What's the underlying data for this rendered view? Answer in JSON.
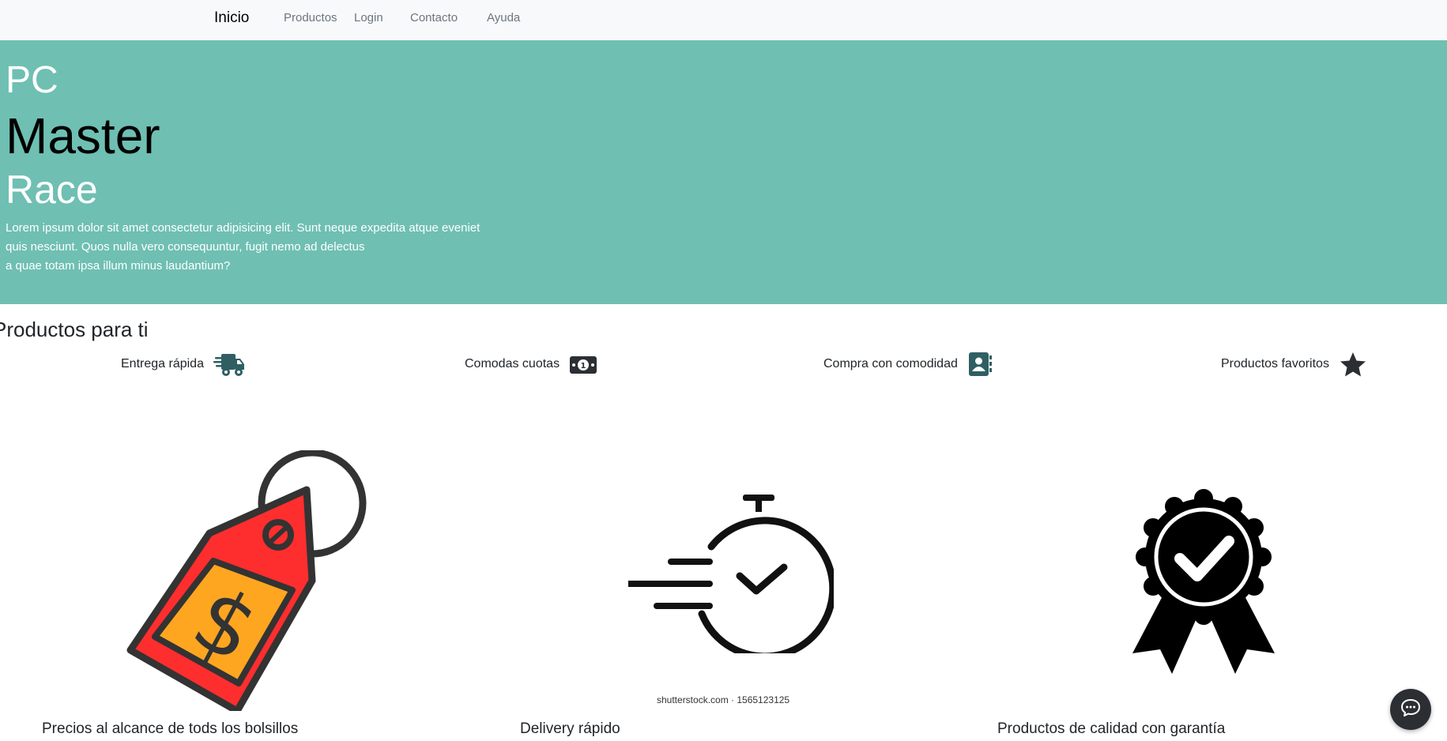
{
  "nav": {
    "brand": "Inicio",
    "links": [
      "Productos",
      "Login",
      "Contacto",
      "Ayuda"
    ]
  },
  "hero": {
    "line1": "PC",
    "line2": "Master",
    "line3": "Race",
    "text_lines": [
      "Lorem ipsum dolor sit amet consectetur adipisicing elit. Sunt neque expedita atque eveniet",
      "quis nesciunt. Quos nulla vero consequuntur, fugit nemo ad delectus",
      "a quae totam ipsa illum minus laudantium?"
    ]
  },
  "section": {
    "title": "Productos para ti",
    "features": [
      {
        "label": "Entrega rápida",
        "icon": "truck-icon"
      },
      {
        "label": "Comodas cuotas",
        "icon": "money-bill-icon"
      },
      {
        "label": "Compra con comodidad",
        "icon": "address-book-icon"
      },
      {
        "label": "Productos favoritos",
        "icon": "star-icon"
      }
    ]
  },
  "cards": [
    {
      "caption": "Precios al alcance de tods los bolsillos",
      "icon": "price-tag-icon"
    },
    {
      "caption": "Delivery rápido",
      "icon": "stopwatch-icon",
      "watermark": "shutterstock.com · 1565123125"
    },
    {
      "caption": "Productos de calidad con garantía",
      "icon": "quality-badge-icon"
    }
  ],
  "colors": {
    "navbar_bg": "#f8f9fa",
    "hero_bg": "#6fbfb3",
    "icon_teal": "#2f5f63"
  },
  "chat": {
    "icon": "chat-bubble-icon"
  }
}
